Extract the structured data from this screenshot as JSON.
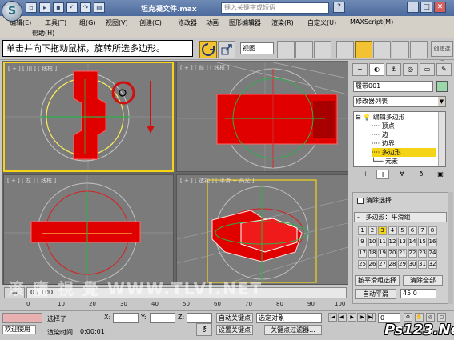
{
  "window": {
    "title": "坦克凝文件.max",
    "search_placeholder": "键入关键字或短语",
    "min": "_",
    "max": "□",
    "close": "✕",
    "help_icon": "?"
  },
  "menu": {
    "items": [
      "编辑(E)",
      "工具(T)",
      "组(G)",
      "视图(V)",
      "创建(C)",
      "修改器",
      "动画",
      "图形编辑器",
      "渲染(R)",
      "自定义(U)",
      "MAXScript(M)",
      "帮助(H)"
    ]
  },
  "toolbar": {
    "tooltip": "单击并向下拖动鼠标，旋转所选多边形。",
    "view_select": "视图",
    "create_selection": "创建选择"
  },
  "viewports": {
    "top": "[ + ] [ 顶 ] [ 线框 ]",
    "front": "[ + ] [ 前 ] [ 线框 ]",
    "left": "[ + ] [ 左 ] [ 线框 ]",
    "persp": "[ + ] [ 透视 ] [ 平滑 + 高光 ]"
  },
  "command_panel": {
    "tabs": [
      "+",
      "◐",
      "⚓",
      "◎",
      "▭",
      "✎"
    ],
    "object_name": "履带001",
    "modifier_list": "修改器列表",
    "stack": {
      "root": "编辑多边形",
      "children": [
        "顶点",
        "边",
        "边界",
        "多边形",
        "元素"
      ],
      "selected": "多边形"
    },
    "clear_selection": "清除选择",
    "rollout_title": "多边形：平滑组",
    "smoothing_groups": [
      "1",
      "2",
      "3",
      "4",
      "5",
      "6",
      "7",
      "8",
      "9",
      "10",
      "11",
      "12",
      "13",
      "14",
      "15",
      "16",
      "17",
      "18",
      "19",
      "20",
      "21",
      "22",
      "23",
      "24",
      "25",
      "26",
      "27",
      "28",
      "29",
      "30",
      "31",
      "32"
    ],
    "active_groups": [
      "3"
    ],
    "select_by_sg": "按平滑组选择",
    "clear_all": "清除全部",
    "auto_smooth": "自动平滑",
    "auto_smooth_value": "45.0"
  },
  "timeline": {
    "position": "0 / 100",
    "ticks": [
      "0",
      "10",
      "20",
      "30",
      "40",
      "50",
      "60",
      "70",
      "80",
      "90",
      "100"
    ]
  },
  "status": {
    "welcome": "欢迎使用",
    "selection": "选择了",
    "render_time_label": "渲染时间",
    "render_time": "0:00:01",
    "x_label": "X:",
    "y_label": "Y:",
    "z_label": "Z:",
    "auto_key": "自动关键点",
    "selected_object": "选定对象",
    "set_key": "设置关键点",
    "key_filter": "关键点过滤器...",
    "frame": "0"
  },
  "watermarks": {
    "left": "滚 鷹 視 覺 WWW.TLVI.NET",
    "right": "Ps123.Net"
  },
  "colors": {
    "selection": "#e00000",
    "gizmo_yellow": "#ffef5a",
    "gizmo_green": "#2bb14a",
    "accent_yellow": "#f5d418"
  }
}
